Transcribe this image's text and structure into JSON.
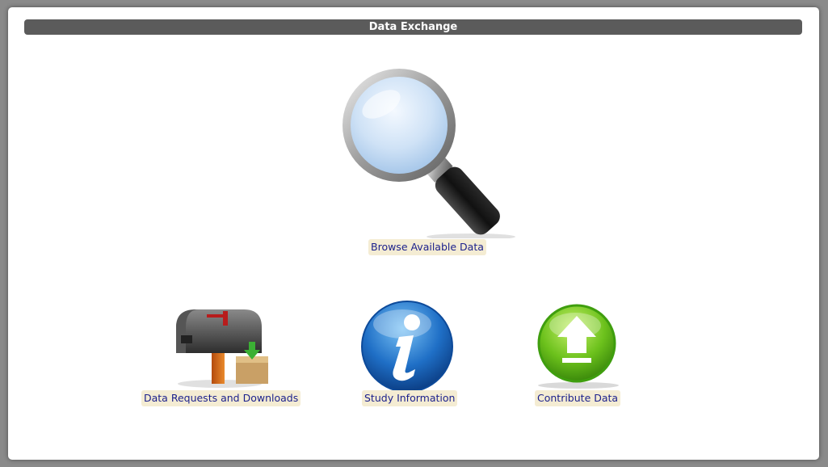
{
  "window": {
    "title": "Data Exchange"
  },
  "tiles": {
    "browse": {
      "label": "Browse Available Data",
      "icon": "magnifying-glass-icon"
    },
    "requests": {
      "label": "Data Requests and Downloads",
      "icon": "mailbox-icon"
    },
    "study": {
      "label": "Study Information",
      "icon": "info-icon"
    },
    "contribute": {
      "label": "Contribute Data",
      "icon": "upload-arrow-icon"
    }
  },
  "colors": {
    "title_bar": "#5b5b5b",
    "label_bg": "#f4ecd3",
    "link_text": "#1a1f8c",
    "info_blue": "#1f6fc6",
    "upload_green": "#6cc11c"
  }
}
